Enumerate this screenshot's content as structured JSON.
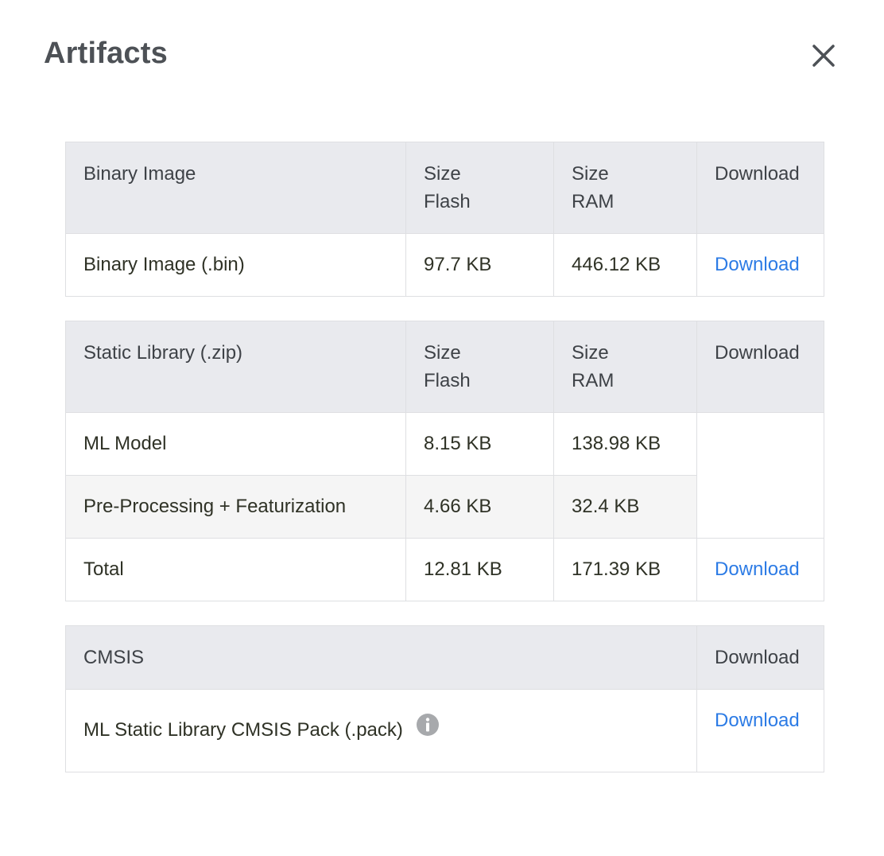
{
  "modal": {
    "title": "Artifacts",
    "close_icon": "close-icon"
  },
  "binary_table": {
    "headers": {
      "name": "Binary Image",
      "flash_line1": "Size",
      "flash_line2": "Flash",
      "ram_line1": "Size",
      "ram_line2": "RAM",
      "download": "Download"
    },
    "rows": [
      {
        "name": "Binary Image (.bin)",
        "flash": "97.7 KB",
        "ram": "446.12 KB",
        "download": "Download"
      }
    ]
  },
  "static_table": {
    "headers": {
      "name": "Static Library (.zip)",
      "flash_line1": "Size",
      "flash_line2": "Flash",
      "ram_line1": "Size",
      "ram_line2": "RAM",
      "download": "Download"
    },
    "rows": [
      {
        "name": "ML Model",
        "flash": "8.15 KB",
        "ram": "138.98 KB"
      },
      {
        "name": "Pre-Processing + Featurization",
        "flash": "4.66 KB",
        "ram": "32.4 KB"
      },
      {
        "name": "Total",
        "flash": "12.81 KB",
        "ram": "171.39 KB",
        "download": "Download"
      }
    ]
  },
  "cmsis_table": {
    "headers": {
      "name": "CMSIS",
      "download": "Download"
    },
    "rows": [
      {
        "name": "ML Static Library CMSIS Pack (.pack)",
        "info_icon": "info-icon",
        "download": "Download"
      }
    ]
  },
  "colors": {
    "link": "#2c7be5",
    "header_bg": "#e9eaee",
    "shaded_row_bg": "#f5f5f5",
    "title": "#4d5156"
  }
}
